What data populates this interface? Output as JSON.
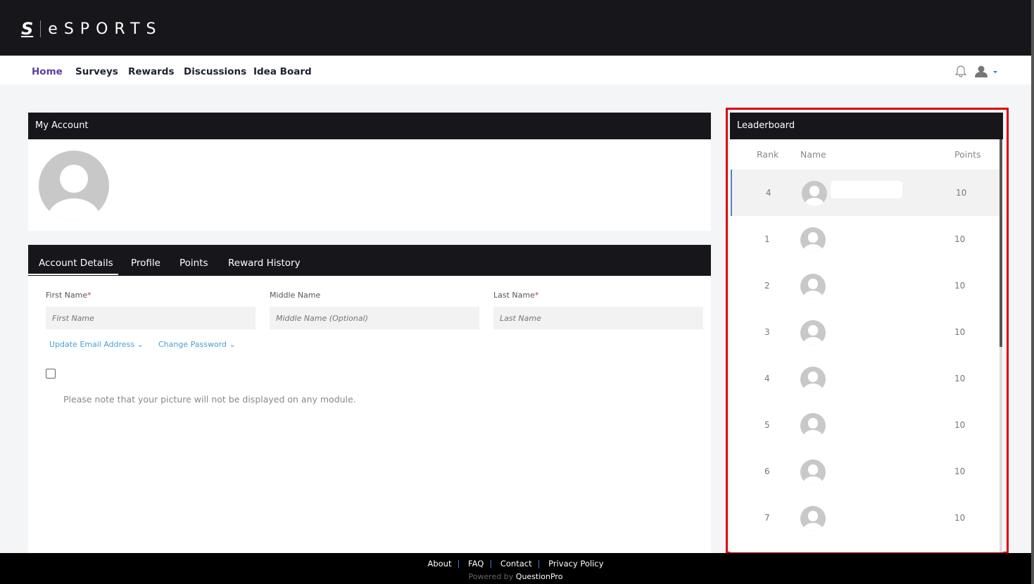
{
  "brand": {
    "mark": "S",
    "name": "eSPORTS"
  },
  "nav": {
    "items": [
      "Home",
      "Surveys",
      "Rewards",
      "Discussions",
      "Idea Board"
    ]
  },
  "account": {
    "title": "My Account"
  },
  "tabs": [
    "Account Details",
    "Profile",
    "Points",
    "Reward History"
  ],
  "form": {
    "first_label": "First Name",
    "first_placeholder": "First Name",
    "middle_label": "Middle Name",
    "middle_placeholder": "Middle Name (Optional)",
    "last_label": "Last Name",
    "last_placeholder": "Last Name",
    "required_mark": "*",
    "update_email": "Update Email Address ⌄",
    "change_password": "Change Password ⌄",
    "note": "Please note that your picture will not be displayed on any module."
  },
  "leaderboard": {
    "title": "Leaderboard",
    "headers": {
      "rank": "Rank",
      "name": "Name",
      "points": "Points"
    },
    "rows": [
      {
        "rank": "4",
        "points": "10"
      },
      {
        "rank": "1",
        "points": "10"
      },
      {
        "rank": "2",
        "points": "10"
      },
      {
        "rank": "3",
        "points": "10"
      },
      {
        "rank": "4",
        "points": "10"
      },
      {
        "rank": "5",
        "points": "10"
      },
      {
        "rank": "6",
        "points": "10"
      },
      {
        "rank": "7",
        "points": "10"
      }
    ]
  },
  "footer": {
    "links": [
      "About",
      "FAQ",
      "Contact",
      "Privacy Policy"
    ],
    "powered": "Powered by",
    "brand": "QuestionPro"
  }
}
